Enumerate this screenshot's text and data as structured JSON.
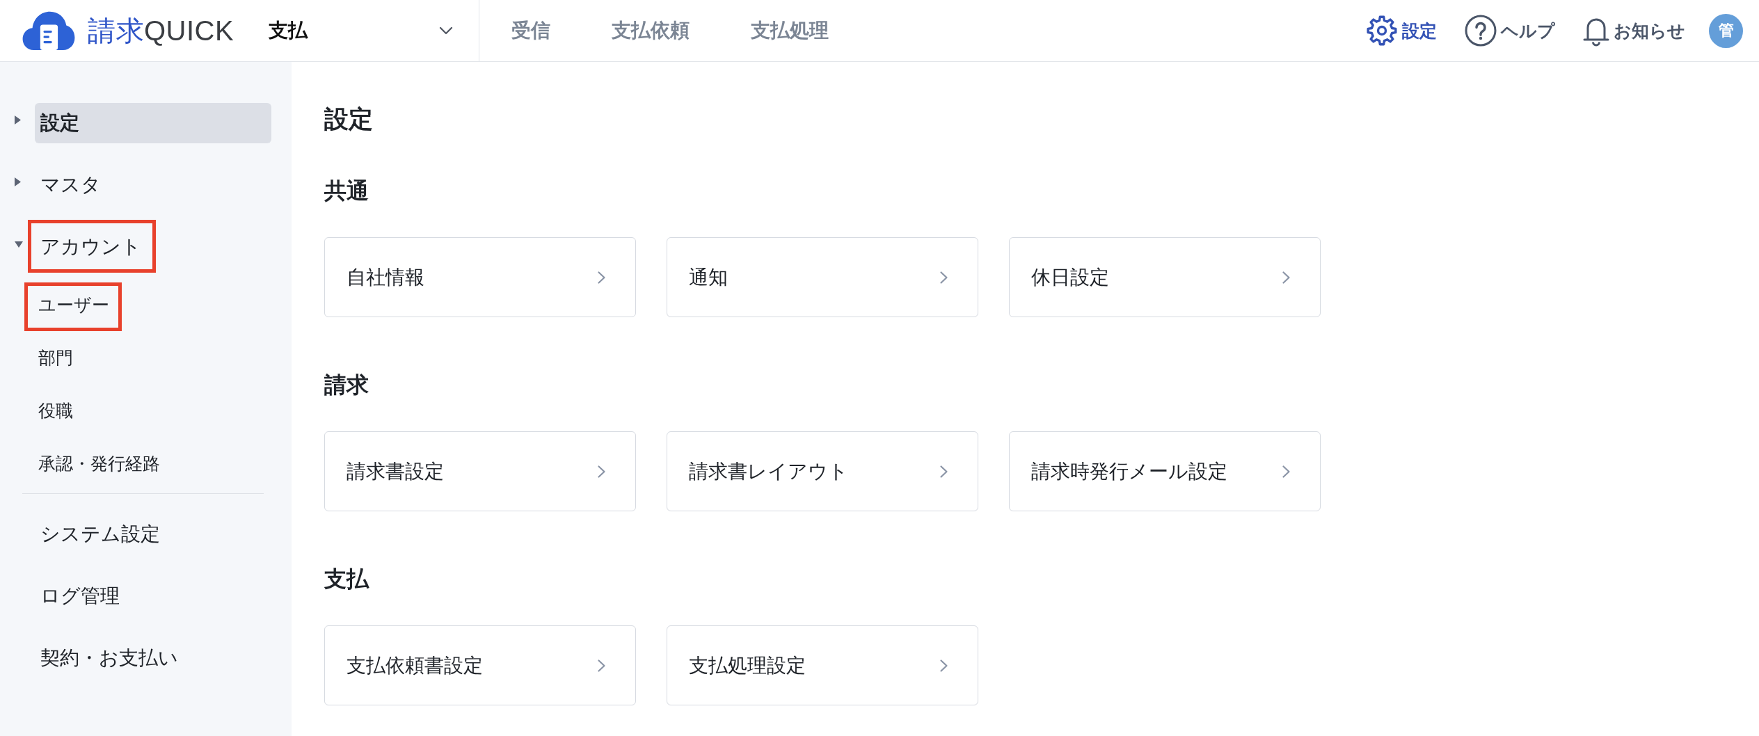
{
  "header": {
    "logo": {
      "prefix": "請求",
      "suffix": "QUICK"
    },
    "module_select": {
      "value": "支払"
    },
    "nav": [
      {
        "label": "受信",
        "selected": false
      },
      {
        "label": "支払依頼",
        "selected": false
      },
      {
        "label": "支払処理",
        "selected": false
      }
    ],
    "actions": [
      {
        "kind": "settings",
        "label": "設定",
        "selected": true
      },
      {
        "kind": "help",
        "label": "ヘルプ",
        "selected": false
      },
      {
        "kind": "notifications",
        "label": "お知らせ",
        "selected": false
      }
    ],
    "avatar": {
      "initial": "管"
    }
  },
  "sidebar": {
    "groups": [
      {
        "label": "設定",
        "selected": true,
        "expanded": false,
        "highlighted": false
      },
      {
        "label": "マスタ",
        "selected": false,
        "expanded": false,
        "highlighted": false
      },
      {
        "label": "アカウント",
        "selected": false,
        "expanded": true,
        "highlighted": true,
        "children": [
          {
            "label": "ユーザー",
            "selected": false,
            "highlighted": true
          },
          {
            "label": "部門",
            "selected": false,
            "highlighted": false
          },
          {
            "label": "役職",
            "selected": false,
            "highlighted": false
          },
          {
            "label": "承認・発行経路",
            "selected": false,
            "highlighted": false
          }
        ]
      }
    ],
    "links": [
      {
        "label": "システム設定",
        "selected": false,
        "highlighted": false
      },
      {
        "label": "ログ管理",
        "selected": false,
        "highlighted": false
      },
      {
        "label": "契約・お支払い",
        "selected": false,
        "highlighted": false
      }
    ]
  },
  "page": {
    "title": "設定",
    "sections": [
      {
        "heading": "共通",
        "cards": [
          {
            "label": "自社情報"
          },
          {
            "label": "通知"
          },
          {
            "label": "休日設定"
          }
        ]
      },
      {
        "heading": "請求",
        "cards": [
          {
            "label": "請求書設定"
          },
          {
            "label": "請求書レイアウト"
          },
          {
            "label": "請求時発行メール設定"
          }
        ]
      },
      {
        "heading": "支払",
        "cards": [
          {
            "label": "支払依頼書設定"
          },
          {
            "label": "支払処理設定"
          }
        ]
      }
    ]
  }
}
